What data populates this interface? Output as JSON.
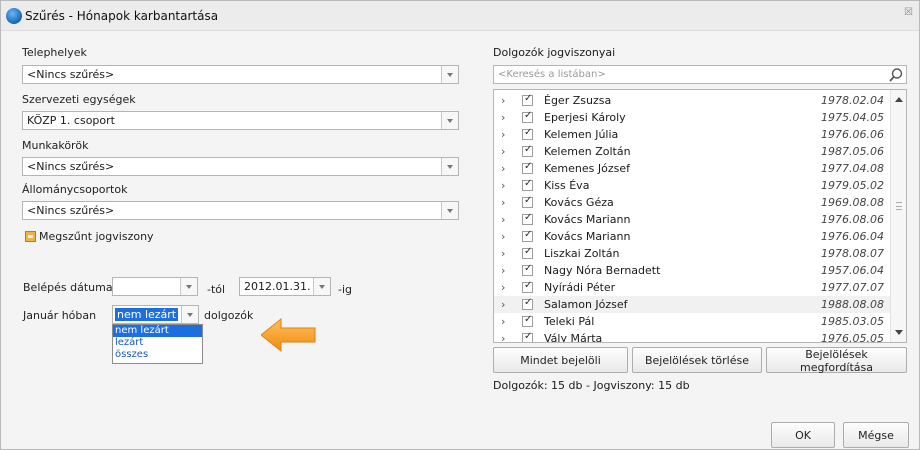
{
  "window": {
    "title": "Szűrés - Hónapok karbantartása"
  },
  "filters": {
    "sites": {
      "label": "Telephelyek",
      "value": "<Nincs szűrés>"
    },
    "org_units": {
      "label": "Szervezeti egységek",
      "value": "KÖZP 1. csoport"
    },
    "jobs": {
      "label": "Munkakörök",
      "value": "<Nincs szűrés>"
    },
    "staff_groups": {
      "label": "Állománycsoportok",
      "value": "<Nincs szűrés>"
    },
    "terminated_label": "Megszűnt jogviszony"
  },
  "entry_date": {
    "label": "Belépés dátuma:",
    "from_value": "",
    "from_suffix": "-tól",
    "to_value": "2012.01.31.",
    "to_suffix": "-ig"
  },
  "month_filter": {
    "label": "Január hóban",
    "value": "nem lezárt",
    "suffix": "dolgozók",
    "options": [
      "nem lezárt",
      "lezárt",
      "összes"
    ]
  },
  "employees": {
    "label": "Dolgozók jogviszonyai",
    "search_placeholder": "<Keresés a listában>",
    "rows": [
      {
        "name": "Éger Zsuzsa",
        "date": "1978.02.04"
      },
      {
        "name": "Eperjesi Károly",
        "date": "1975.04.05"
      },
      {
        "name": "Kelemen Júlia",
        "date": "1976.06.06"
      },
      {
        "name": "Kelemen Zoltán",
        "date": "1987.05.06"
      },
      {
        "name": "Kemenes József",
        "date": "1977.04.08"
      },
      {
        "name": "Kiss Éva",
        "date": "1979.05.02"
      },
      {
        "name": "Kovács Géza",
        "date": "1969.08.08"
      },
      {
        "name": "Kovács Mariann",
        "date": "1976.08.06"
      },
      {
        "name": "Kovács Mariann",
        "date": "1976.06.04"
      },
      {
        "name": "Liszkai Zoltán",
        "date": "1978.08.07"
      },
      {
        "name": "Nagy Nóra Bernadett",
        "date": "1957.06.04"
      },
      {
        "name": "Nyírádi Péter",
        "date": "1977.07.07"
      },
      {
        "name": "Salamon József",
        "date": "1988.08.08"
      },
      {
        "name": "Teleki Pál",
        "date": "1985.03.05"
      },
      {
        "name": "Vály Márta",
        "date": "1976.05.05"
      }
    ],
    "buttons": {
      "select_all": "Mindet bejelöli",
      "clear": "Bejelölések törlése",
      "invert": "Bejelölések megfordítása"
    },
    "status": "Dolgozók: 15 db - Jogviszony: 15 db"
  },
  "footer": {
    "ok": "OK",
    "cancel": "Mégse"
  },
  "colors": {
    "selection": "#1d6fe0",
    "arrow": "#f49a1a",
    "checkbox_orange": "#f3b144"
  }
}
